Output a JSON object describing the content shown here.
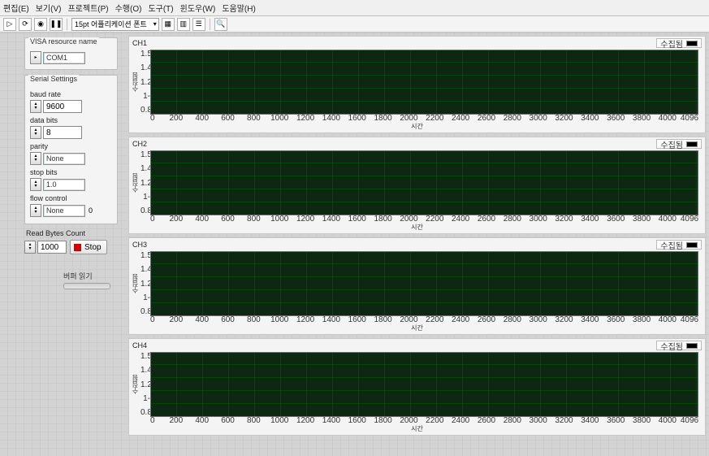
{
  "menu": {
    "items": [
      "편집(E)",
      "보기(V)",
      "프로젝트(P)",
      "수행(O)",
      "도구(T)",
      "윈도우(W)",
      "도움말(H)"
    ]
  },
  "toolbar": {
    "font_select": "15pt 어플리케이션 폰트"
  },
  "left": {
    "visa_title": "VISA resource name",
    "visa_value": "COM1",
    "serial_title": "Serial Settings",
    "baud_label": "baud rate",
    "baud_value": "9600",
    "databits_label": "data bits",
    "databits_value": "8",
    "parity_label": "parity",
    "parity_value": "None",
    "stopbits_label": "stop bits",
    "stopbits_value": "1.0",
    "flow_label": "flow control",
    "flow_value": "None",
    "flow_extra": "0",
    "read_label": "Read Bytes Count",
    "read_value": "1000",
    "stop_label": "Stop",
    "buffer_label": "버퍼 읽기"
  },
  "charts": [
    {
      "title": "CH1",
      "legend": "수집됨"
    },
    {
      "title": "CH2",
      "legend": "수집됨"
    },
    {
      "title": "CH3",
      "legend": "수집됨"
    },
    {
      "title": "CH4",
      "legend": "수집됨"
    }
  ],
  "chart_data": [
    {
      "type": "line",
      "title": "CH1",
      "ylabel": "수집됨",
      "xlabel": "시간",
      "yticks": [
        "1.5",
        "1.4",
        "1.2",
        "1",
        "0.8"
      ],
      "xticks": [
        "0",
        "200",
        "400",
        "600",
        "800",
        "1000",
        "1200",
        "1400",
        "1600",
        "1800",
        "2000",
        "2200",
        "2400",
        "2600",
        "2800",
        "3000",
        "3200",
        "3400",
        "3600",
        "3800",
        "4000",
        "4096"
      ],
      "ylim": [
        0.8,
        1.5
      ],
      "xlim": [
        0,
        4096
      ],
      "values": []
    },
    {
      "type": "line",
      "title": "CH2",
      "ylabel": "수집됨",
      "xlabel": "시간",
      "yticks": [
        "1.5",
        "1.4",
        "1.2",
        "1",
        "0.8"
      ],
      "xticks": [
        "0",
        "200",
        "400",
        "600",
        "800",
        "1000",
        "1200",
        "1400",
        "1600",
        "1800",
        "2000",
        "2200",
        "2400",
        "2600",
        "2800",
        "3000",
        "3200",
        "3400",
        "3600",
        "3800",
        "4000",
        "4096"
      ],
      "ylim": [
        0.8,
        1.5
      ],
      "xlim": [
        0,
        4096
      ],
      "values": []
    },
    {
      "type": "line",
      "title": "CH3",
      "ylabel": "수집됨",
      "xlabel": "시간",
      "yticks": [
        "1.5",
        "1.4",
        "1.2",
        "1",
        "0.8"
      ],
      "xticks": [
        "0",
        "200",
        "400",
        "600",
        "800",
        "1000",
        "1200",
        "1400",
        "1600",
        "1800",
        "2000",
        "2200",
        "2400",
        "2600",
        "2800",
        "3000",
        "3200",
        "3400",
        "3600",
        "3800",
        "4000",
        "4096"
      ],
      "ylim": [
        0.8,
        1.5
      ],
      "xlim": [
        0,
        4096
      ],
      "values": []
    },
    {
      "type": "line",
      "title": "CH4",
      "ylabel": "수집됨",
      "xlabel": "시간",
      "yticks": [
        "1.5",
        "1.4",
        "1.2",
        "1",
        "0.8"
      ],
      "xticks": [
        "0",
        "200",
        "400",
        "600",
        "800",
        "1000",
        "1200",
        "1400",
        "1600",
        "1800",
        "2000",
        "2200",
        "2400",
        "2600",
        "2800",
        "3000",
        "3200",
        "3400",
        "3600",
        "3800",
        "4000",
        "4096"
      ],
      "ylim": [
        0.8,
        1.5
      ],
      "xlim": [
        0,
        4096
      ],
      "values": []
    }
  ]
}
